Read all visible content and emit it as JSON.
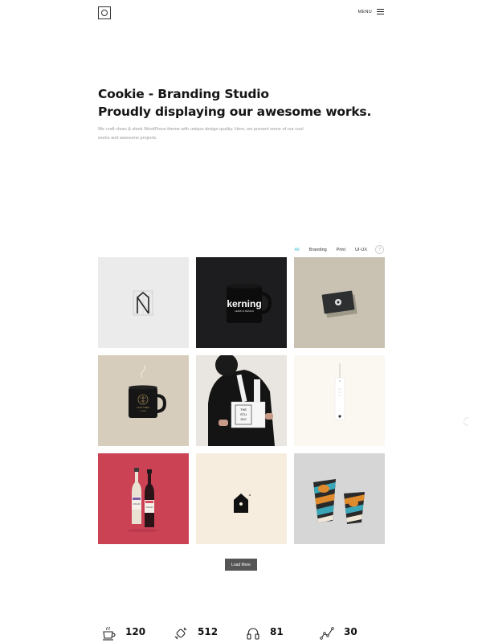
{
  "header": {
    "logo_icon": "square-circle-logo-icon",
    "menu_label": "MENU",
    "menu_icon": "hamburger-icon"
  },
  "hero": {
    "title_line1": "Cookie - Branding Studio",
    "title_line2": "Proudly displaying our awesome works.",
    "description": "We craft clean & sleek WordPress theme with unique design quality. Here, we present some of our cool works and awesome projects."
  },
  "filters": {
    "items": [
      "All",
      "Branding",
      "Print",
      "UI-UX"
    ],
    "active": "All",
    "extra_icon": "question-icon",
    "accent_color": "#3ac1d6"
  },
  "portfolio": {
    "tiles": [
      {
        "name": "n-logo-grid",
        "bg": "#ebebeb"
      },
      {
        "name": "kerning-mug",
        "bg": "#1d1d1f",
        "text": "kerning",
        "subtext": "LEARN & DESIGN"
      },
      {
        "name": "dark-business-card",
        "bg": "#c9c2b3"
      },
      {
        "name": "black-mug-emblem",
        "bg": "#d7cdbd",
        "text": "VOLTYRES",
        "subtext": "COFFEE"
      },
      {
        "name": "woman-with-box",
        "bg": "#e9e5e0",
        "text": "THE STUDIO"
      },
      {
        "name": "hang-tag",
        "bg": "#fbf7f1"
      },
      {
        "name": "wine-bottles",
        "bg": "#cb4255",
        "text": "COLLIN"
      },
      {
        "name": "house-logo",
        "bg": "#f6eddf"
      },
      {
        "name": "striped-cups",
        "bg": "#d6d6d6"
      }
    ]
  },
  "load_more_label": "Load More",
  "stats": [
    {
      "icon": "coffee-cup-icon",
      "value": "120"
    },
    {
      "icon": "candy-icon",
      "value": "512"
    },
    {
      "icon": "headphones-icon",
      "value": "81"
    },
    {
      "icon": "line-chart-icon",
      "value": "30"
    }
  ]
}
